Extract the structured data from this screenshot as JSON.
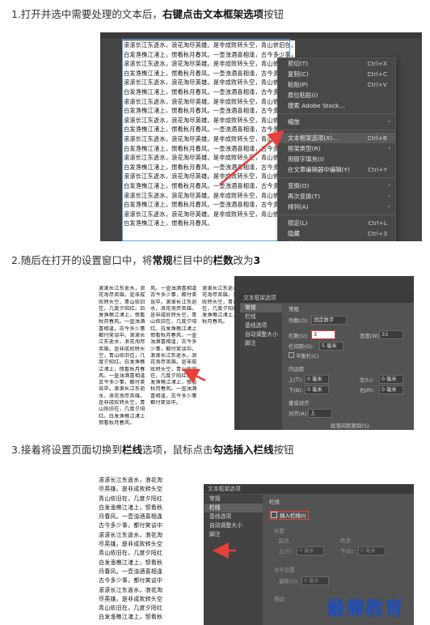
{
  "steps": [
    {
      "title_prefix": "1.打开并选中需要处理的文本后，",
      "title_bold_1": "右键点击文本框架选项",
      "title_suffix": "按钮"
    },
    {
      "title_prefix": "2.随后在打开的设置窗口中，将",
      "title_bold_1": "常规",
      "title_mid": "栏目中的",
      "title_bold_2": "栏数",
      "title_mid2": "改为",
      "title_bold_3": "3"
    },
    {
      "title_prefix": "3.接着将设置页面切换到",
      "title_bold_1": "栏线",
      "title_mid": "选项，鼠标点击",
      "title_bold_2": "勾选插入栏线",
      "title_suffix": "按钮"
    }
  ],
  "doc1_lines": [
    "滚滚长江东逝水，浪花淘尽英雄。是非成败转头空，青山依旧在，几度夕阳红。",
    "白发渔樵江渚上，惯看秋月春风。一壶浊酒喜相逢，古今多少事，都付笑谈中。",
    "滚滚长江东逝水，浪花淘尽英雄。是非成败转头空，青山依旧在，几度夕阳红。",
    "白发渔樵江渚上，惯看秋月春风。一壶浊酒喜相逢，古今多少事，都付笑谈中。",
    "滚滚长江东逝水，浪花淘尽英雄。是非成败转头空，青山依旧在，几度夕阳红。",
    "白发渔樵江渚上，惯看秋月春风。一壶浊酒喜相逢，古今多少事，都付笑谈中。",
    "滚滚长江东逝水，浪花淘尽英雄。是非成败转头空，青山依旧在，几度夕阳红。",
    "白发渔樵江渚上，惯看秋月春风。一壶浊酒喜相逢，古今多少事，都付笑谈中。",
    "滚滚长江东逝水，浪花淘尽英雄。是非成败转头空，青山依旧在，几度夕阳红。",
    "白发渔樵江渚上，惯看秋月春风。一壶浊酒喜相逢，古今多少事，都付笑谈中。",
    "滚滚长江东逝水，浪花淘尽英雄。是非成败转头空，青山依旧在，几度夕阳红。",
    "白发渔樵江渚上，惯看秋月春风。一壶浊酒喜相逢，古今多少事，都付笑谈中。",
    "滚滚长江东逝水，浪花淘尽英雄。是非成败转头空，青山依旧在，几度夕阳红。",
    "白发渔樵江渚上，惯看秋月春风。一壶浊酒喜相逢，古今多少事，都付笑谈中。",
    "滚滚长江东逝水，浪花淘尽英雄。是非成败转头空，青山依旧在，几度夕阳红。",
    "白发渔樵江渚上，惯看秋月春风。一壶浊酒喜相逢，古今多少事，都付笑谈中。",
    "滚滚长江东逝水，浪花淘尽英雄。是非成败转头空，青山依旧在，几度夕阳红。",
    "白发渔樵江渚上，惯看秋月春风。一壶浊酒喜相逢，古今多少事，都付笑谈中。",
    "滚滚长江东逝水，浪花淘尽英雄。是非成败转头空，青山依旧在，几度夕阳红。",
    "白发渔樵江渚上，惯看秋月春风。"
  ],
  "context_menu": {
    "items": [
      {
        "label": "剪切(T)",
        "shortcut": "Ctrl+X"
      },
      {
        "label": "复制(C)",
        "shortcut": "Ctrl+C"
      },
      {
        "label": "粘贴(P)",
        "shortcut": "Ctrl+V"
      },
      {
        "label": "原位粘贴(I)",
        "shortcut": ""
      },
      {
        "label": "搜索 Adobe Stock...",
        "shortcut": ""
      },
      {
        "label": "缩放",
        "shortcut": "",
        "submenu": true
      },
      {
        "label": "文本框架选项(X)...",
        "shortcut": "Ctrl+B"
      },
      {
        "label": "框架类型(R)",
        "shortcut": "",
        "submenu": true
      },
      {
        "label": "用假字填充(I)",
        "shortcut": ""
      },
      {
        "label": "在文章编辑器中编辑(Y)",
        "shortcut": "Ctrl+Y"
      },
      {
        "label": "变换(O)",
        "shortcut": "",
        "submenu": true
      },
      {
        "label": "再次变换(T)",
        "shortcut": "",
        "submenu": true
      },
      {
        "label": "排列(A)",
        "shortcut": "",
        "submenu": true
      },
      {
        "label": "锁定(L)",
        "shortcut": "Ctrl+L"
      },
      {
        "label": "隐藏",
        "shortcut": "Ctrl+3"
      },
      {
        "label": "描边粗细",
        "shortcut": "",
        "submenu": true
      }
    ]
  },
  "dialog2": {
    "title": "文本框架选项",
    "nav": [
      "常规",
      "栏线",
      "基线选项",
      "自动调整大小",
      "脚注"
    ],
    "section_label": "常规",
    "columns_label": "列数(O):",
    "columns_mode": "固定数字",
    "count_label": "栏数(U):",
    "count_value": "3",
    "gutter_label": "栏间距(G):",
    "gutter_value": "5 毫米",
    "width_label": "宽度(W):",
    "width_value": "33",
    "balance_label": "平衡栏(C)",
    "inset_group": "内边距",
    "top_label": "上(T):",
    "top_value": "0 毫米",
    "bottom_label": "下(B):",
    "bottom_value": "0 毫米",
    "left_label": "左(L):",
    "right_label": "右(R):",
    "vertical_label": "垂直对齐",
    "align_label": "对齐(A):",
    "align_value": "上",
    "para_spacing_label": "段落间距限制(S):"
  },
  "doc2_cols": [
    [
      "滚滚长江东逝水，浪",
      "花淘尽英雄。是非成",
      "败转头空，青山依旧",
      "在，几度夕阳红。白",
      "发渔樵江渚上，惯看",
      "秋月春风。一壶浊酒",
      "喜相逢，古今多少事",
      "都付笑谈中。滚滚长",
      "江东逝水，浪花淘尽",
      "英雄。是非成败转头",
      "空，青山依旧在，几",
      "度夕阳红。白发渔樵",
      "江渚上，惯看秋月春",
      "风。一壶浊酒喜相逢",
      "古今多少事，都付笑",
      "谈中。滚滚长江东逝",
      "水，浪花淘尽英雄。",
      "是非成败转头空，青",
      "山依旧在，几度夕阳",
      "红。白发渔樵江渚上",
      "惯看秋月春风。"
    ],
    [
      "风。一壶浊酒喜相逢",
      "古今多少事，都付笑",
      "谈中。滚滚长江东逝",
      "水，浪花淘尽英雄。",
      "是非成败转头空，青",
      "山依旧在，几度夕阳",
      "红。白发渔樵江渚上",
      "惯看秋月春风。一壶",
      "浊酒喜相逢，古今多",
      "少事，都付笑谈中。",
      "滚滚长江东逝水，浪",
      "花淘尽英雄。是非成",
      "败转头空，青山依旧",
      "在，几度夕阳红。白",
      "发渔樵江渚上，惯看",
      "秋月春风。一壶浊酒",
      "喜相逢，古今多少事",
      "都付笑谈中。"
    ],
    [
      "滚滚长江东逝水，浪",
      "花淘尽英雄。是非成",
      "败转头空，青山依旧",
      "在，几度夕阳红。白",
      "发渔樵江渚上，惯看",
      "秋月春风。"
    ]
  ],
  "dialog3": {
    "title": "文本框架选项",
    "nav": [
      "常规",
      "栏线",
      "基线选项",
      "自动调整大小",
      "脚注"
    ],
    "section_label": "栏线",
    "insert_label": "插入栏线(I)",
    "length_group": "长度",
    "start_label": "起点",
    "top_label": "上(T):",
    "top_value": "0 毫米",
    "end_label": "终点",
    "bottom_label": "下(B):",
    "bottom_value": "0 毫米",
    "horiz_group": "水平位置",
    "offset_label": "偏移(O):",
    "offset_value": "0 毫米",
    "stroke_group": "描边"
  },
  "doc3_lines": [
    "滚滚长江东逝水，浪花淘",
    "尽英雄。是非成败转头空",
    "青山依旧在，几度夕阳红",
    "白发渔樵江渚上，惯看秋",
    "月春风。一壶浊酒喜相逢",
    "古今多少事，都付笑谈中",
    "滚滚长江东逝水，浪花淘",
    "尽英雄。是非成败转头空",
    "青山依旧在，几度夕阳红",
    "白发渔樵江渚上，惯看秋",
    "月春风。一壶浊酒喜相逢",
    "古今多少事，都付笑谈中",
    "滚滚长江东逝水，浪花淘",
    "尽英雄。是非成败转头空",
    "青山依旧在，几度夕阳红",
    "白发渔樵江渚上，惯看秋"
  ],
  "watermark": "最需教育",
  "colors": {
    "arrow": "#e8403a",
    "dark_panel": "#535353",
    "menu": "#484848",
    "watermark": "#1f4fb8"
  }
}
